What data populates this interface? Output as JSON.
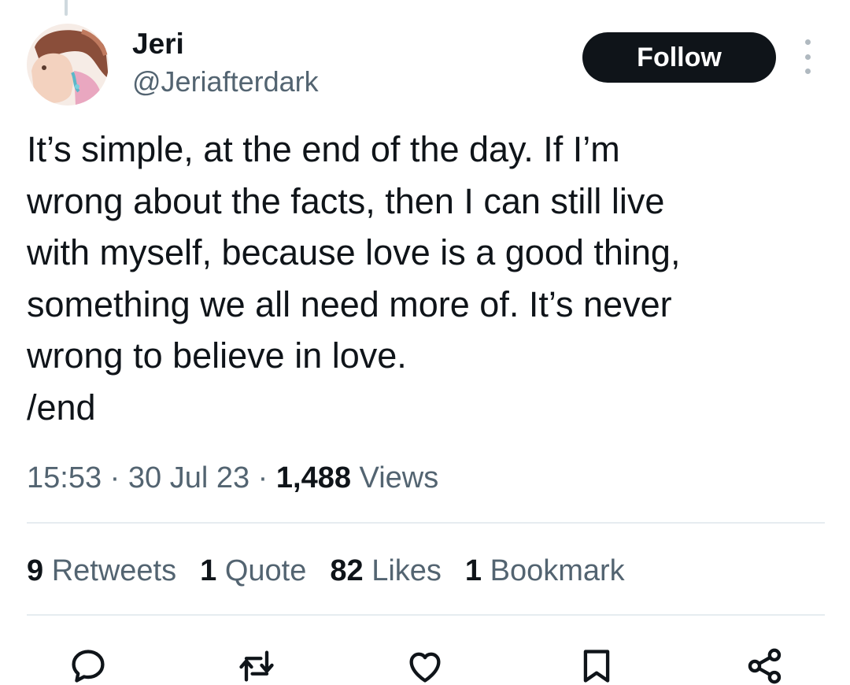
{
  "author": {
    "display_name": "Jeri",
    "handle": "@Jeriafterdark"
  },
  "follow_label": "Follow",
  "tweet": {
    "text": "It’s simple, at the end of the day. If I’m\nwrong about the facts, then I can still live\nwith myself, because love is a good thing,\nsomething we all need more of. It’s never\nwrong to believe in love.\n/end"
  },
  "meta": {
    "time": "15:53",
    "separator": "·",
    "date": "30 Jul 23",
    "views_count": "1,488",
    "views_label": "Views"
  },
  "stats": [
    {
      "count": "9",
      "label": "Retweets"
    },
    {
      "count": "1",
      "label": "Quote"
    },
    {
      "count": "82",
      "label": "Likes"
    },
    {
      "count": "1",
      "label": "Bookmark"
    }
  ],
  "actions": [
    "reply-icon",
    "retweet-icon",
    "like-icon",
    "bookmark-icon",
    "share-icon"
  ],
  "colors": {
    "text_primary": "#0f1419",
    "text_secondary": "#536471",
    "follow_bg": "#0f1419",
    "divider": "#e6ecf0"
  }
}
